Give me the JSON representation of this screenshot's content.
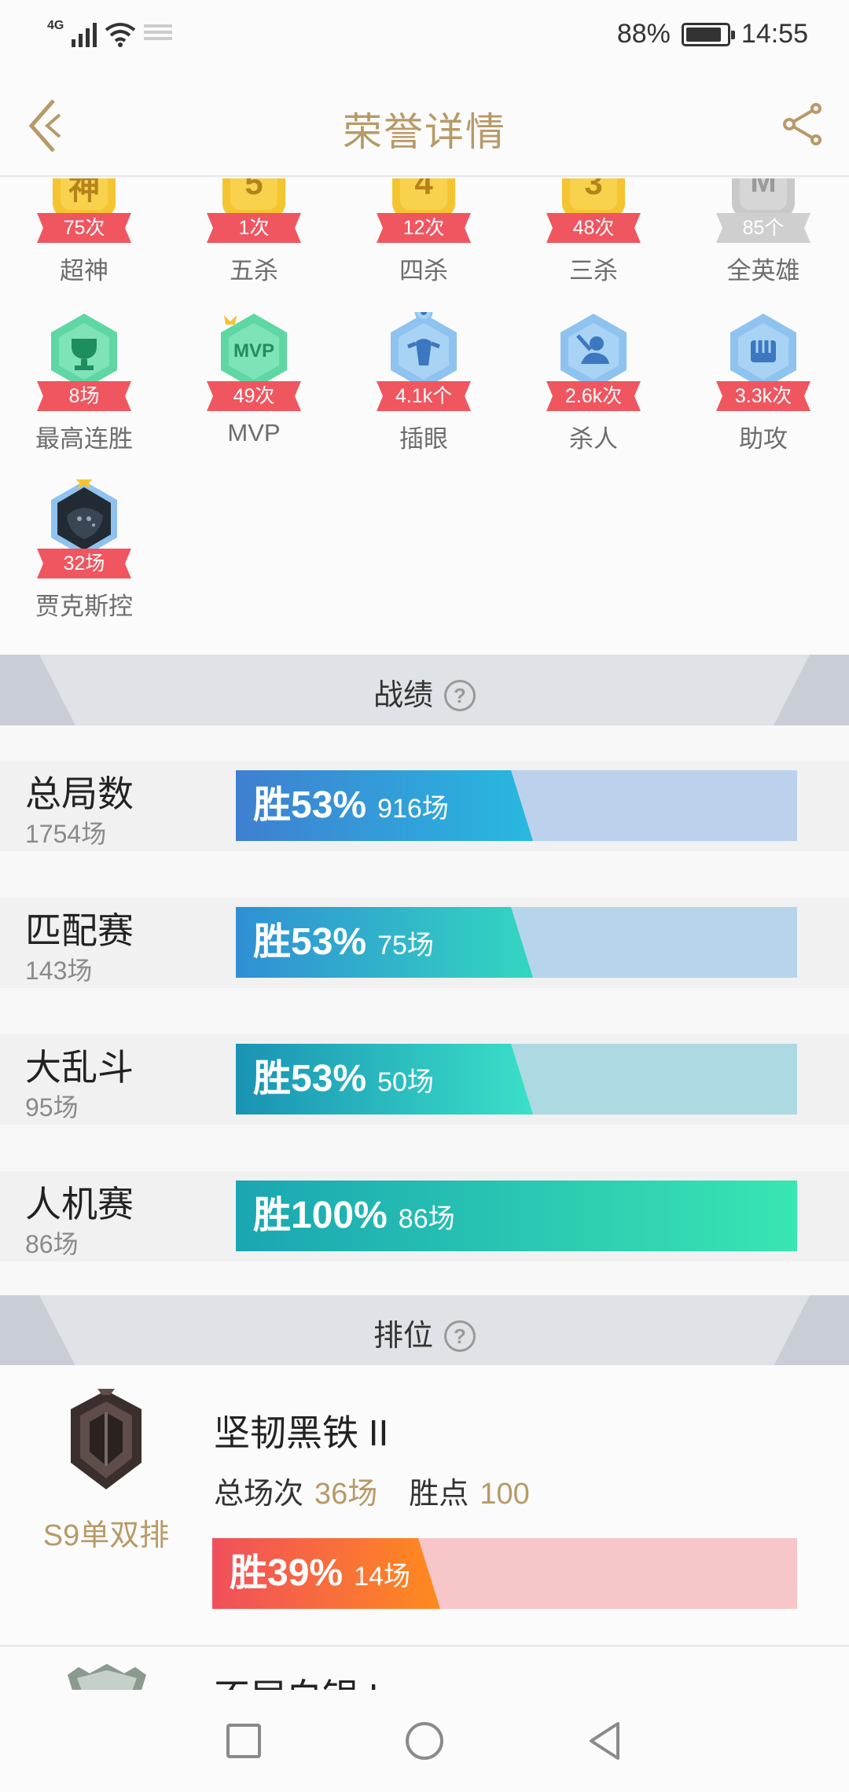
{
  "status_bar": {
    "network": "4G",
    "battery": "88%",
    "battery_level": 0.88,
    "time": "14:55"
  },
  "header": {
    "title": "荣誉详情",
    "back_icon": "chevron-left-icon",
    "share_icon": "share-icon"
  },
  "honors": [
    {
      "label": "超神",
      "value": "75次",
      "glyph": "神",
      "color": "#f5c431"
    },
    {
      "label": "五杀",
      "value": "1次",
      "glyph": "5",
      "color": "#f5c431"
    },
    {
      "label": "四杀",
      "value": "12次",
      "glyph": "4",
      "color": "#f5c431"
    },
    {
      "label": "三杀",
      "value": "48次",
      "glyph": "3",
      "color": "#f5c431"
    },
    {
      "label": "全英雄",
      "value": "85个",
      "glyph": "M",
      "color": "#c9c9c9"
    },
    {
      "label": "最高连胜",
      "value": "8场",
      "icon": "trophy-icon",
      "color": "#5fd7a3"
    },
    {
      "label": "MVP",
      "value": "49次",
      "glyph": "MVP",
      "color": "#5fd7a3"
    },
    {
      "label": "插眼",
      "value": "4.1k个",
      "icon": "ward-icon",
      "color": "#8fc3ef"
    },
    {
      "label": "杀人",
      "value": "2.6k次",
      "icon": "kill-icon",
      "color": "#8fc3ef"
    },
    {
      "label": "助攻",
      "value": "3.3k次",
      "icon": "assist-icon",
      "color": "#8fc3ef"
    },
    {
      "label": "贾克斯控",
      "value": "32场",
      "icon": "champion-portrait-icon",
      "color": "#8fc3ef"
    }
  ],
  "stats_section": {
    "title": "战绩",
    "rows": [
      {
        "name": "总局数",
        "count": "1754场",
        "win_pct": "胜53%",
        "wins": "916场",
        "win_rate": 0.53,
        "fill_from": "#3f7fd1",
        "fill_to": "#27b9e0",
        "track": "#bcd2ec"
      },
      {
        "name": "匹配赛",
        "count": "143场",
        "win_pct": "胜53%",
        "wins": "75场",
        "win_rate": 0.53,
        "fill_from": "#2f8fd4",
        "fill_to": "#33d6c0",
        "track": "#b6d5eb"
      },
      {
        "name": "大乱斗",
        "count": "95场",
        "win_pct": "胜53%",
        "wins": "50场",
        "win_rate": 0.53,
        "fill_from": "#1a92b4",
        "fill_to": "#3ae0c8",
        "track": "#acd9e2"
      },
      {
        "name": "人机赛",
        "count": "86场",
        "win_pct": "胜100%",
        "wins": "86场",
        "win_rate": 1.0,
        "fill_from": "#1aa6b2",
        "fill_to": "#39e6b2",
        "track": "#b2e6d6"
      }
    ]
  },
  "ranked_section": {
    "title": "排位",
    "entry": {
      "season": "S9单双排",
      "rank": "坚韧黑铁 II",
      "total_label": "总场次",
      "total_value": "36场",
      "points_label": "胜点",
      "points_value": "100",
      "win_pct": "胜39%",
      "wins": "14场",
      "win_rate": 0.39,
      "fill_from": "#f04f5c",
      "fill_to": "#ff8a1e",
      "track": "#f7c6c9"
    },
    "next_entry_rank": "不屈白银 I"
  }
}
